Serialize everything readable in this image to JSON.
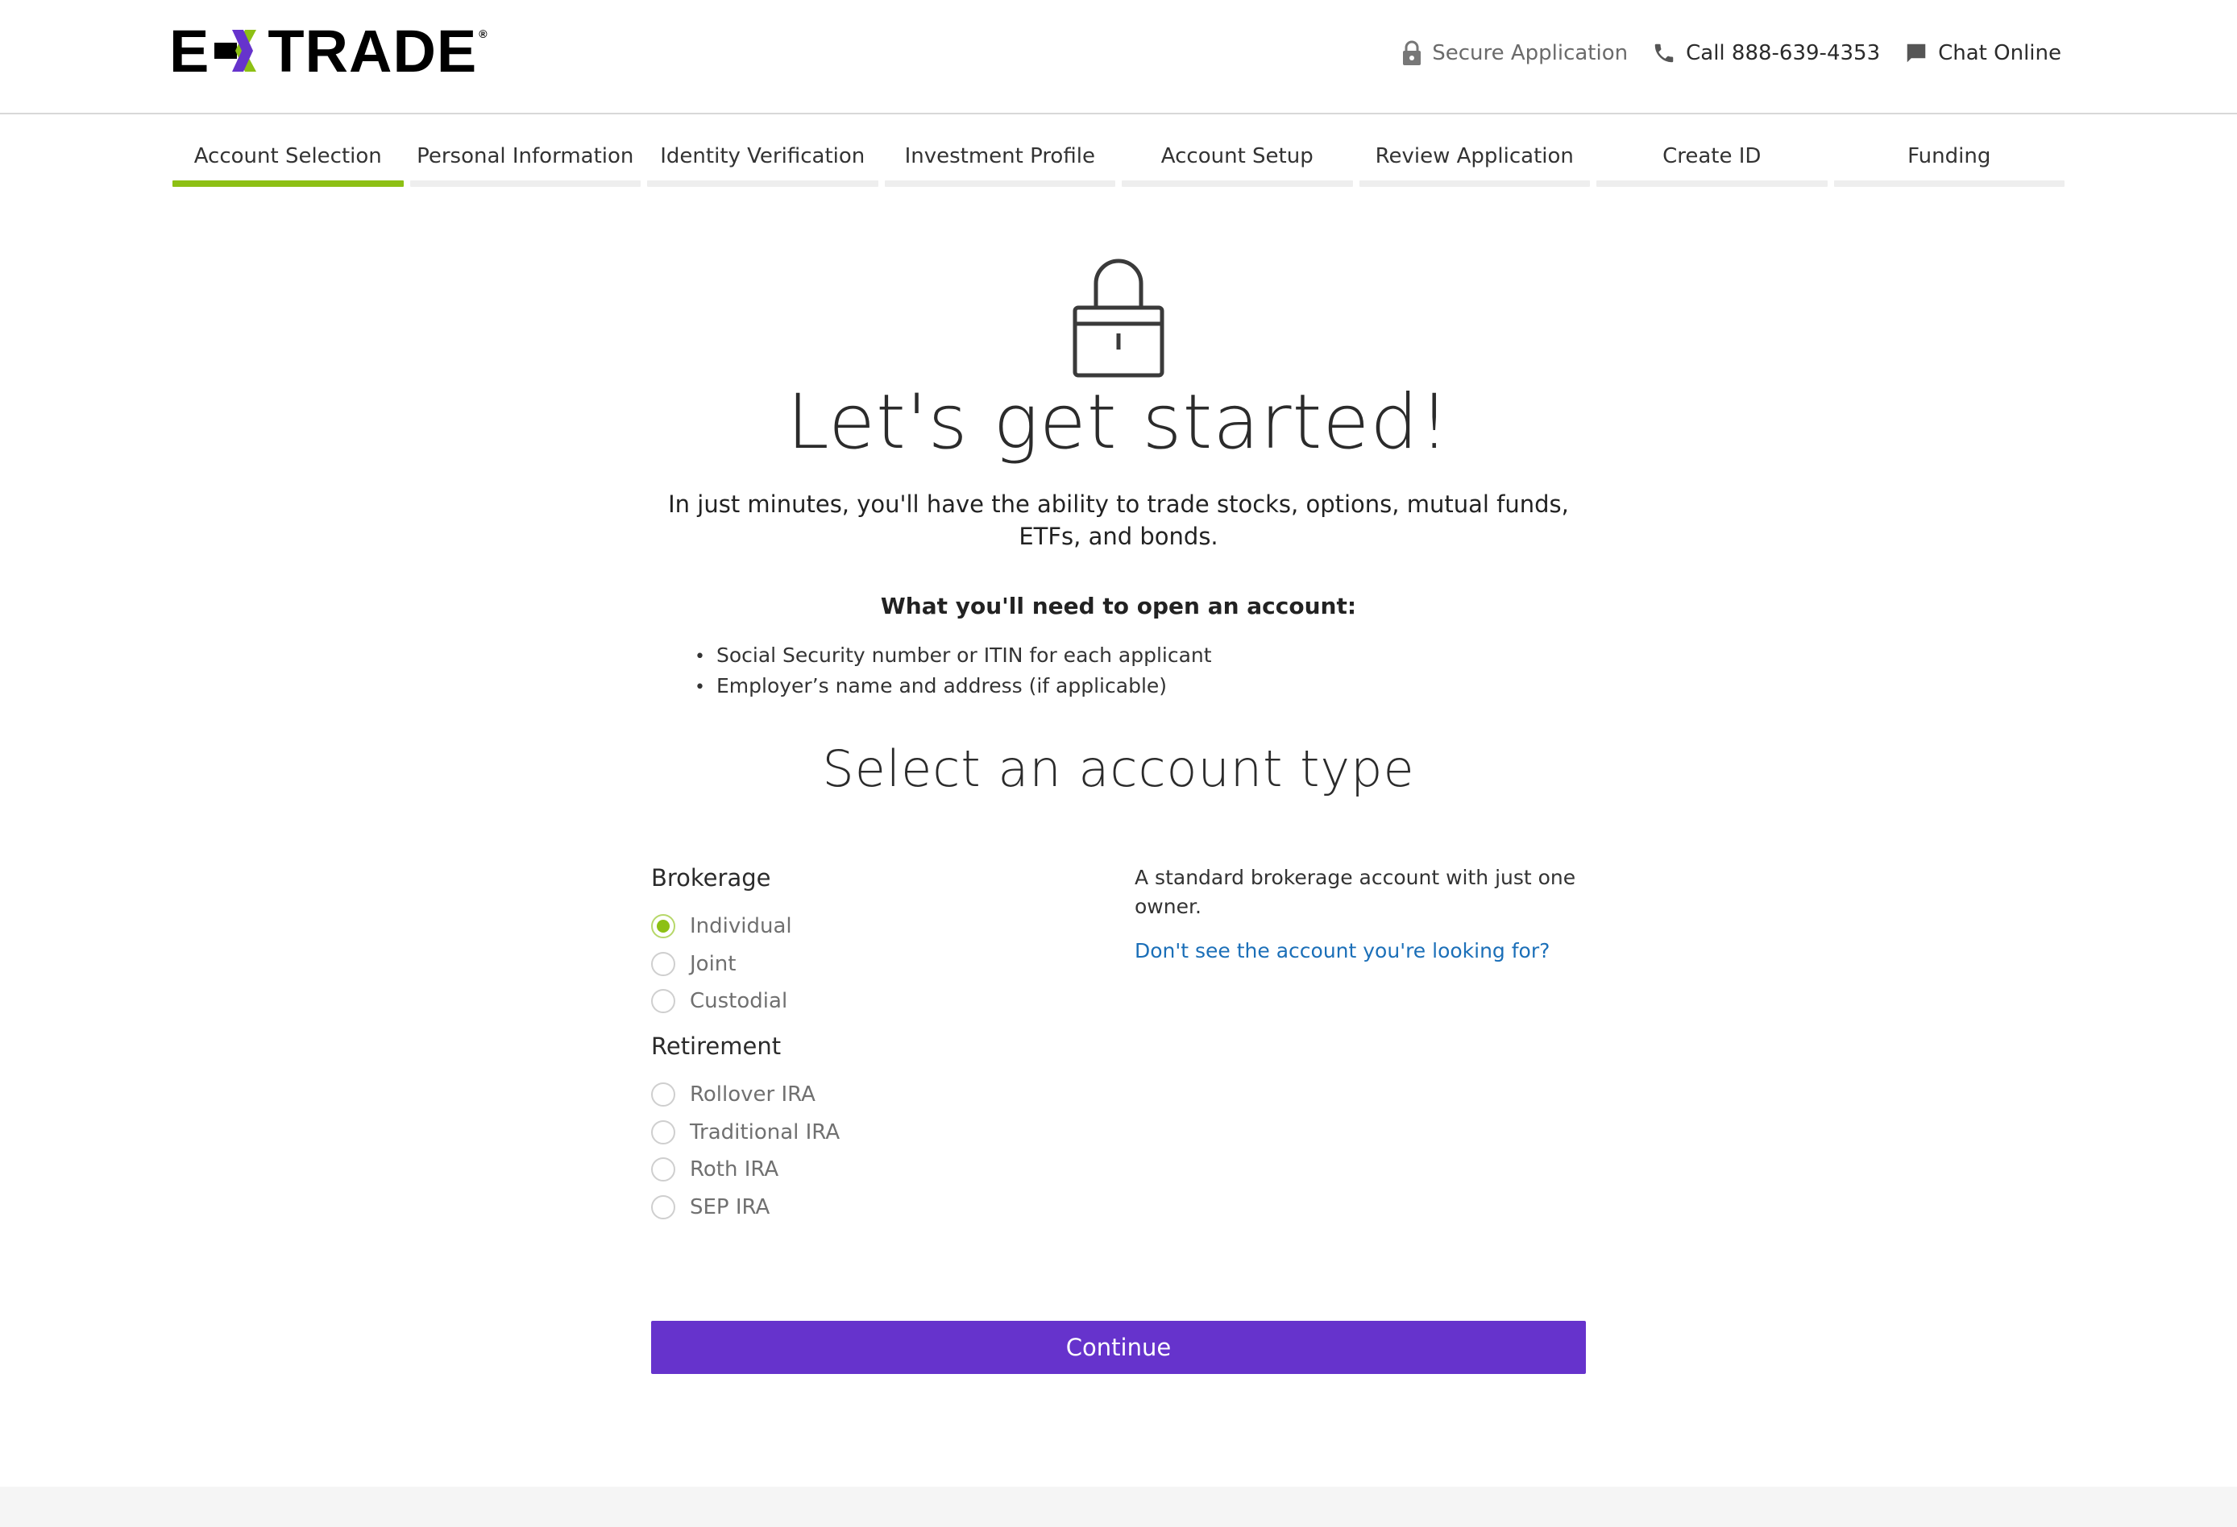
{
  "brand": {
    "logo_left": "E",
    "logo_right": "TRADE",
    "registered": "®",
    "accent_purple": "#6633cc",
    "accent_green": "#8dc014"
  },
  "header": {
    "secure_label": "Secure Application",
    "call_label": "Call 888-639-4353",
    "chat_label": "Chat Online"
  },
  "steps": [
    {
      "label": "Account Selection",
      "active": true
    },
    {
      "label": "Personal Information",
      "active": false
    },
    {
      "label": "Identity Verification",
      "active": false
    },
    {
      "label": "Investment Profile",
      "active": false
    },
    {
      "label": "Account Setup",
      "active": false
    },
    {
      "label": "Review Application",
      "active": false
    },
    {
      "label": "Create ID",
      "active": false
    },
    {
      "label": "Funding",
      "active": false
    }
  ],
  "main": {
    "title": "Let's get started!",
    "intro": "In just minutes, you'll have the ability to trade stocks, options, mutual funds, ETFs, and bonds.",
    "need_title": "What you'll need to open an account:",
    "need_items": [
      "Social Security number or ITIN for each applicant",
      "Employer’s name and address (if applicable)"
    ],
    "select_title": "Select an account type"
  },
  "account_types": {
    "brokerage_title": "Brokerage",
    "brokerage_options": [
      "Individual",
      "Joint",
      "Custodial"
    ],
    "retirement_title": "Retirement",
    "retirement_options": [
      "Rollover IRA",
      "Traditional IRA",
      "Roth IRA",
      "SEP IRA"
    ],
    "selected": "Individual",
    "description": "A standard brokerage account with just one owner.",
    "help_link": "Don't see the account you're looking for?"
  },
  "actions": {
    "continue_label": "Continue"
  }
}
